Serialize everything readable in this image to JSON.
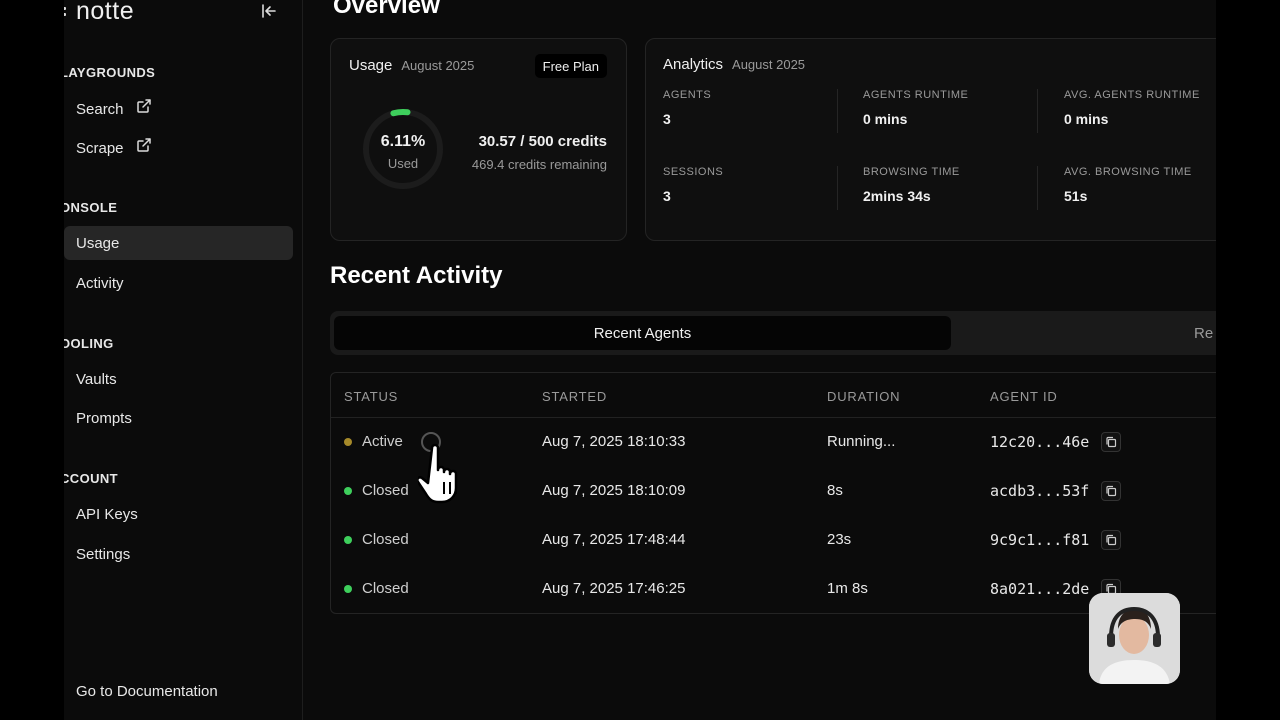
{
  "brand": {
    "name": "notte"
  },
  "sidebar": {
    "sections": [
      {
        "label": "LAYGROUNDS"
      },
      {
        "label": "ONSOLE"
      },
      {
        "label": "OOLING"
      },
      {
        "label": "CCOUNT"
      }
    ],
    "items": [
      {
        "label": "Search",
        "icon": "search-icon",
        "external": true
      },
      {
        "label": "Scrape",
        "icon": "scrape-icon",
        "external": true
      },
      {
        "label": "Usage",
        "icon": "usage-icon",
        "active": true
      },
      {
        "label": "Activity",
        "icon": "activity-icon"
      },
      {
        "label": "Vaults",
        "icon": "vault-icon"
      },
      {
        "label": "Prompts",
        "icon": "prompt-icon"
      },
      {
        "label": "API Keys",
        "icon": "key-icon"
      },
      {
        "label": "Settings",
        "icon": "gear-icon"
      }
    ],
    "doc_link": "Go to Documentation"
  },
  "main": {
    "title": "Overview",
    "usage": {
      "title": "Usage",
      "month": "August 2025",
      "plan": "Free Plan",
      "percent": "6.11%",
      "percent_value": 6.11,
      "used_label": "Used",
      "credits": "30.57 / 500 credits",
      "remaining": "469.4 credits remaining"
    },
    "analytics": {
      "title": "Analytics",
      "month": "August 2025",
      "metrics": [
        {
          "label": "AGENTS",
          "value": "3"
        },
        {
          "label": "AGENTS RUNTIME",
          "value": "0 mins"
        },
        {
          "label": "AVG. AGENTS RUNTIME",
          "value": "0 mins"
        },
        {
          "label": "SESSIONS",
          "value": "3"
        },
        {
          "label": "BROWSING TIME",
          "value": "2mins 34s"
        },
        {
          "label": "AVG. BROWSING TIME",
          "value": "51s"
        }
      ]
    },
    "recent_title": "Recent Activity",
    "tabs": [
      {
        "label": "Recent Agents",
        "active": true
      },
      {
        "label": "Re"
      }
    ],
    "table": {
      "headers": [
        "STATUS",
        "STARTED",
        "DURATION",
        "AGENT ID"
      ],
      "rows": [
        {
          "status": "Active",
          "started": "Aug 7, 2025 18:10:33",
          "duration": "Running...",
          "agent_id": "12c20...46e",
          "status_color": "#a68a2a"
        },
        {
          "status": "Closed",
          "started": "Aug 7, 2025 18:10:09",
          "duration": "8s",
          "agent_id": "acdb3...53f",
          "status_color": "#3ecf5c"
        },
        {
          "status": "Closed",
          "started": "Aug 7, 2025 17:48:44",
          "duration": "23s",
          "agent_id": "9c9c1...f81",
          "status_color": "#3ecf5c"
        },
        {
          "status": "Closed",
          "started": "Aug 7, 2025 17:46:25",
          "duration": "1m 8s",
          "agent_id": "8a021...2de",
          "status_color": "#3ecf5c"
        }
      ]
    }
  },
  "colors": {
    "accent_green": "#3ecf5c",
    "active_amber": "#a68a2a",
    "background": "#0b0b0b"
  }
}
